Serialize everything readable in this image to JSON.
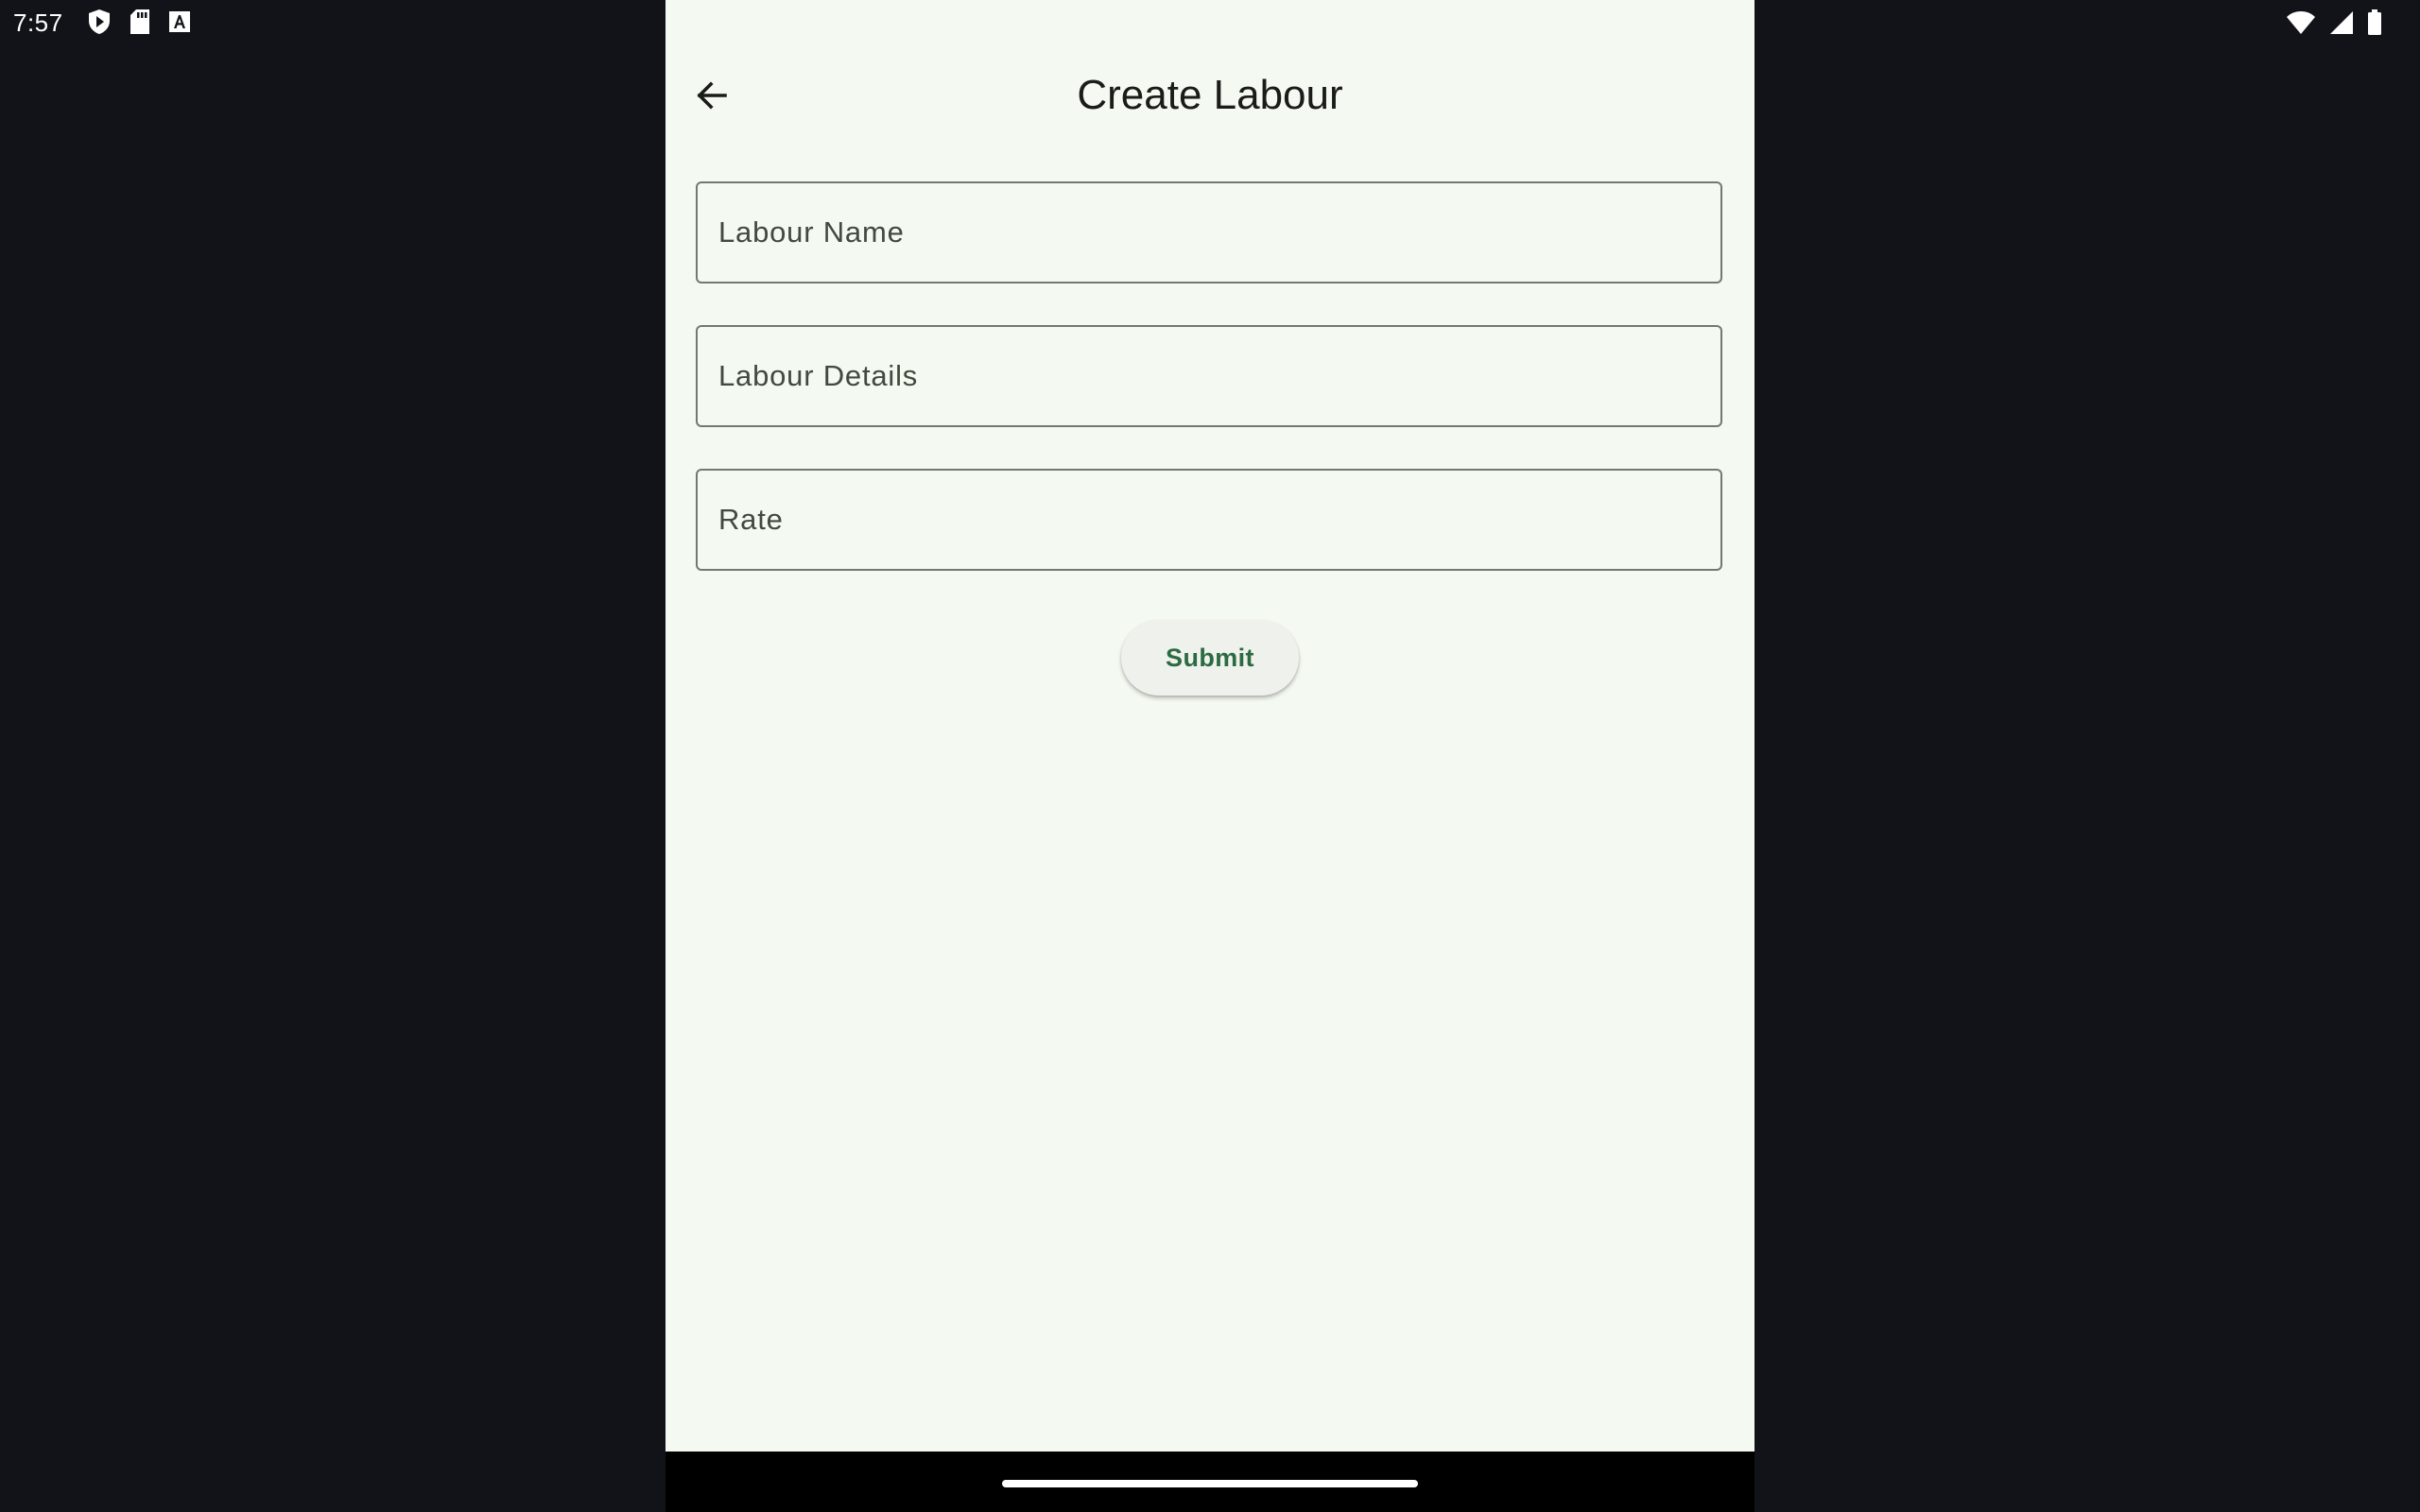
{
  "status_bar": {
    "time": "7:57",
    "left_icons": [
      "play-protect-icon",
      "sd-card-icon",
      "font-a-icon"
    ],
    "right_icons": [
      "wifi-icon",
      "cellular-signal-icon",
      "battery-icon"
    ]
  },
  "app_bar": {
    "title": "Create Labour",
    "back_icon": "arrow-left-icon"
  },
  "form": {
    "labour_name": {
      "placeholder": "Labour Name",
      "value": ""
    },
    "labour_details": {
      "placeholder": "Labour Details",
      "value": ""
    },
    "rate": {
      "placeholder": "Rate",
      "value": ""
    },
    "submit_label": "Submit"
  },
  "colors": {
    "background": "#f4f9f1",
    "outer_background": "#111318",
    "primary": "#2c6a43",
    "outline": "#72796f",
    "on_surface": "#191c19"
  }
}
